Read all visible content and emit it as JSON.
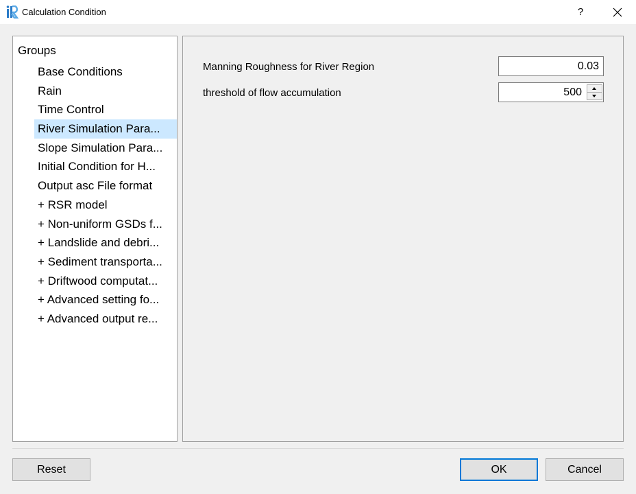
{
  "window": {
    "title": "Calculation Condition",
    "help_label": "?"
  },
  "groups": {
    "header": "Groups",
    "items": [
      {
        "label": "Base Conditions"
      },
      {
        "label": "Rain"
      },
      {
        "label": "Time Control"
      },
      {
        "label": "River Simulation Para..."
      },
      {
        "label": "Slope Simulation Para..."
      },
      {
        "label": "Initial Condition for H..."
      },
      {
        "label": "Output asc File format"
      },
      {
        "label": "+ RSR model"
      },
      {
        "label": "+ Non-uniform GSDs f..."
      },
      {
        "label": "+ Landslide and debri..."
      },
      {
        "label": "+ Sediment transporta..."
      },
      {
        "label": "+ Driftwood computat..."
      },
      {
        "label": "+ Advanced setting fo..."
      },
      {
        "label": "+ Advanced output re..."
      }
    ],
    "selected_index": 3
  },
  "params": {
    "manning": {
      "label": "Manning Roughness for River Region",
      "value": "0.03"
    },
    "threshold": {
      "label": "threshold of flow accumulation",
      "value": "500"
    }
  },
  "buttons": {
    "reset": "Reset",
    "ok": "OK",
    "cancel": "Cancel"
  },
  "colors": {
    "selection": "#cce8ff",
    "accent": "#0078d7"
  }
}
